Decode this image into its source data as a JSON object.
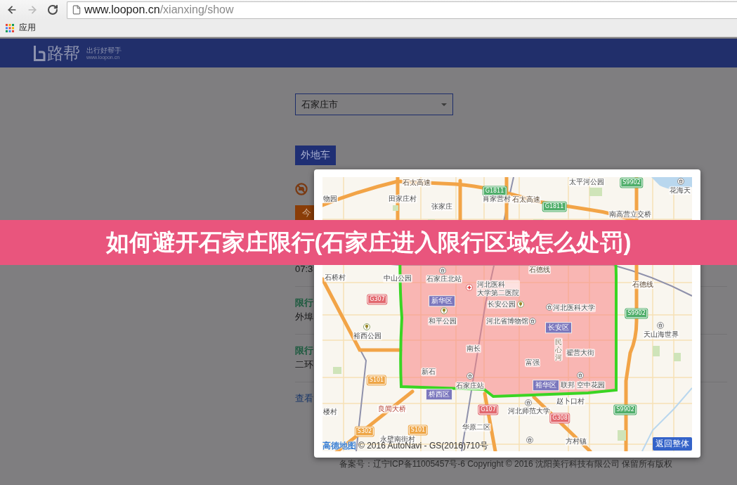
{
  "browser": {
    "nav_buttons": [
      {
        "kind": "back",
        "disabled": false
      },
      {
        "kind": "forward",
        "disabled": true
      },
      {
        "kind": "reload",
        "disabled": false
      }
    ],
    "url": {
      "host": "www.loopon.cn",
      "path": "/xianxing/show"
    },
    "bookmarks": [
      {
        "kind": "apps",
        "label": "应用"
      }
    ]
  },
  "site_header": {
    "logo_text": "路帮",
    "tagline": "出行好帮手",
    "site_url": "www.loopon.cn"
  },
  "city_select": {
    "value": "石家庄市"
  },
  "vehicle_button": {
    "label": "外地车"
  },
  "day_tab": {
    "label": "今"
  },
  "rules": [
    {
      "value": "07:3"
    },
    {
      "label": "限行",
      "value": "外埠"
    },
    {
      "label": "限行",
      "value": "二环"
    }
  ],
  "more_link": {
    "label": "查看"
  },
  "footer": {
    "text": "备案号：辽宁ICP备11005457号-6 Copyright © 2016 沈阳美行科技有限公司 保留所有版权"
  },
  "map_dialog": {
    "labels": [
      {
        "kind": "road",
        "text": "石太高速"
      },
      {
        "kind": "place",
        "text": "太平河公园"
      },
      {
        "kind": "expressway",
        "text": "S9902"
      },
      {
        "kind": "expressway",
        "text": "G1811"
      },
      {
        "kind": "place",
        "text": "花海天"
      },
      {
        "kind": "place",
        "text": "物园"
      },
      {
        "kind": "place",
        "text": "田家庄村"
      },
      {
        "kind": "place",
        "text": "肖家营村"
      },
      {
        "kind": "road",
        "text": "石太高速"
      },
      {
        "kind": "place",
        "text": "张家庄"
      },
      {
        "kind": "expressway",
        "text": "G1811"
      },
      {
        "kind": "place",
        "text": "南高营立交桥"
      },
      {
        "kind": "road",
        "text": "石德线"
      },
      {
        "kind": "place",
        "text": "石桥村"
      },
      {
        "kind": "place",
        "text": "中山公园"
      },
      {
        "kind": "place",
        "text": "石家庄北站"
      },
      {
        "kind": "place",
        "lines": [
          "河北医科",
          "大学第二医院"
        ]
      },
      {
        "kind": "road",
        "text": "石德线"
      },
      {
        "kind": "national",
        "text": "G307"
      },
      {
        "kind": "district",
        "text": "新华区"
      },
      {
        "kind": "place",
        "text": "长安公园"
      },
      {
        "kind": "place",
        "text": "河北医科大学"
      },
      {
        "kind": "expressway",
        "text": "S9902"
      },
      {
        "kind": "place",
        "text": "和平公园"
      },
      {
        "kind": "place",
        "text": "河北省博物馆"
      },
      {
        "kind": "district",
        "text": "长安区"
      },
      {
        "kind": "place",
        "text": "裕西公园"
      },
      {
        "kind": "place",
        "text": "天山海世界"
      },
      {
        "kind": "place",
        "text": "南长"
      },
      {
        "kind": "river",
        "text": "民心河"
      },
      {
        "kind": "place",
        "text": "翟营大街"
      },
      {
        "kind": "place",
        "text": "富强"
      },
      {
        "kind": "place",
        "text": "新石"
      },
      {
        "kind": "provincial",
        "text": "S101"
      },
      {
        "kind": "place",
        "text": "石家庄站"
      },
      {
        "kind": "district",
        "text": "裕华区"
      },
      {
        "kind": "place",
        "text": "联邦"
      },
      {
        "kind": "place",
        "text": "空中花园"
      },
      {
        "kind": "district",
        "text": "桥西区"
      },
      {
        "kind": "place",
        "text": "赵卜口村"
      },
      {
        "kind": "place",
        "text": "楼村"
      },
      {
        "kind": "bridge",
        "text": "良闻大桥"
      },
      {
        "kind": "national",
        "text": "G107"
      },
      {
        "kind": "place",
        "text": "河北师范大学"
      },
      {
        "kind": "expressway",
        "text": "S9902"
      },
      {
        "kind": "national",
        "text": "G308"
      },
      {
        "kind": "provincial",
        "text": "S302"
      },
      {
        "kind": "provincial",
        "text": "S101"
      },
      {
        "kind": "place",
        "text": "华原二区"
      },
      {
        "kind": "place",
        "text": "永壁南街村"
      },
      {
        "kind": "place",
        "text": "方村镇"
      }
    ],
    "attribution": {
      "logo": "高德地图",
      "text": "© 2016 AutoNavi - GS(2016)710号"
    },
    "reset_button": {
      "label": "返回整体"
    }
  },
  "banner": {
    "title": "如何避开石家庄限行(石家庄进入限行区域怎么处罚)"
  }
}
